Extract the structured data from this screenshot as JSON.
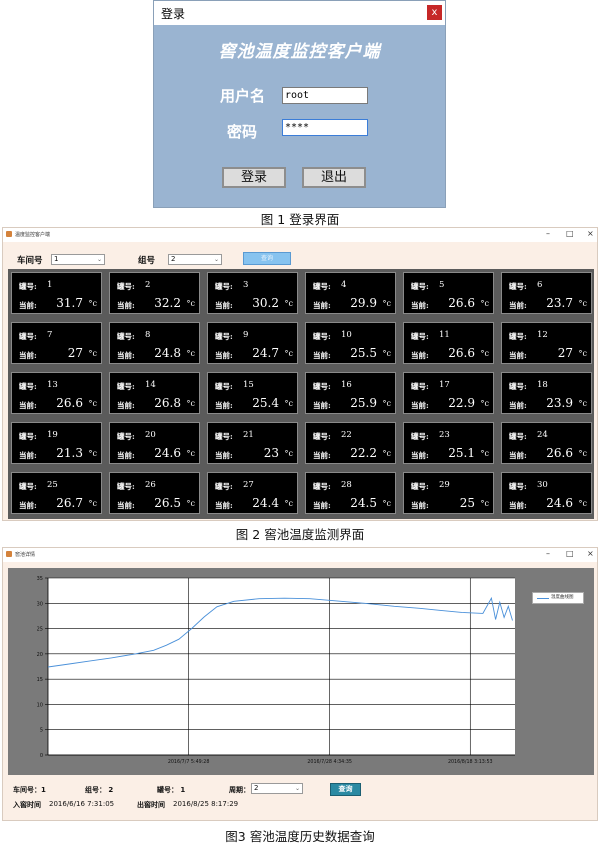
{
  "login": {
    "window_title": "登录",
    "close_label": "x",
    "app_title": "窖池温度监控客户端",
    "username_label": "用户名",
    "username_value": "root",
    "password_label": "密码",
    "password_value": "****",
    "login_button": "登录",
    "exit_button": "退出",
    "caption": "图 1  登录界面"
  },
  "monitor": {
    "window_title": "温度监控客户端",
    "controls": [
      "–",
      "□",
      "×"
    ],
    "workshop_label": "车间号",
    "workshop_value": "1",
    "group_label": "组号",
    "group_value": "2",
    "query_button": "查询",
    "tank_label": "罐号:",
    "current_label": "当前:",
    "unit": "°c",
    "tanks": [
      {
        "id": "1",
        "temp": "31.7"
      },
      {
        "id": "2",
        "temp": "32.2"
      },
      {
        "id": "3",
        "temp": "30.2"
      },
      {
        "id": "4",
        "temp": "29.9"
      },
      {
        "id": "5",
        "temp": "26.6"
      },
      {
        "id": "6",
        "temp": "23.7"
      },
      {
        "id": "7",
        "temp": "27"
      },
      {
        "id": "8",
        "temp": "24.8"
      },
      {
        "id": "9",
        "temp": "24.7"
      },
      {
        "id": "10",
        "temp": "25.5"
      },
      {
        "id": "11",
        "temp": "26.6"
      },
      {
        "id": "12",
        "temp": "27"
      },
      {
        "id": "13",
        "temp": "26.6"
      },
      {
        "id": "14",
        "temp": "26.8"
      },
      {
        "id": "15",
        "temp": "25.4"
      },
      {
        "id": "16",
        "temp": "25.9"
      },
      {
        "id": "17",
        "temp": "22.9"
      },
      {
        "id": "18",
        "temp": "23.9"
      },
      {
        "id": "19",
        "temp": "21.3"
      },
      {
        "id": "20",
        "temp": "24.6"
      },
      {
        "id": "21",
        "temp": "23"
      },
      {
        "id": "22",
        "temp": "22.2"
      },
      {
        "id": "23",
        "temp": "25.1"
      },
      {
        "id": "24",
        "temp": "26.6"
      },
      {
        "id": "25",
        "temp": "26.7"
      },
      {
        "id": "26",
        "temp": "26.5"
      },
      {
        "id": "27",
        "temp": "24.4"
      },
      {
        "id": "28",
        "temp": "24.5"
      },
      {
        "id": "29",
        "temp": "25"
      },
      {
        "id": "30",
        "temp": "24.6"
      }
    ],
    "caption": "图 2  窖池温度监测界面"
  },
  "history": {
    "window_title": "窖池详情",
    "controls": [
      "–",
      "□",
      "×"
    ],
    "legend": "温度曲线图",
    "workshop_text": "车间号：1",
    "group_text": "组号：  2",
    "tank_text": "罐号：  1",
    "period_label": "周期：",
    "period_value": "2",
    "query_button": "查询",
    "in_time_label": "入窖时间",
    "in_time_value": "2016/6/16 7:31:05",
    "out_time_label": "出窖时间",
    "out_time_value": "2016/8/25 8:17:29",
    "caption": "图3  窖池温度历史数据查询",
    "line_color": "#4a90d9"
  },
  "chart_data": {
    "type": "line",
    "ylim": [
      0,
      35
    ],
    "yticks": [
      "0",
      "5",
      "10",
      "15",
      "20",
      "25",
      "30",
      "35"
    ],
    "xlim": [
      0,
      1
    ],
    "xticks": [
      {
        "x": 0.333,
        "label": "2016/7/7 5:49:28"
      },
      {
        "x": 0.667,
        "label": "2016/7/28 4:34:35"
      },
      {
        "x": 1.0,
        "label": "2016/8/18 3:13:53"
      }
    ],
    "series": [
      {
        "values": [
          [
            0.0,
            17.4
          ],
          [
            0.05,
            18.0
          ],
          [
            0.1,
            18.6
          ],
          [
            0.15,
            19.2
          ],
          [
            0.2,
            19.9
          ],
          [
            0.25,
            20.7
          ],
          [
            0.28,
            21.7
          ],
          [
            0.31,
            22.9
          ],
          [
            0.34,
            25.0
          ],
          [
            0.37,
            27.3
          ],
          [
            0.4,
            29.3
          ],
          [
            0.44,
            30.4
          ],
          [
            0.5,
            30.9
          ],
          [
            0.56,
            31.0
          ],
          [
            0.62,
            30.9
          ],
          [
            0.68,
            30.5
          ],
          [
            0.75,
            30.0
          ],
          [
            0.82,
            29.4
          ],
          [
            0.88,
            29.0
          ],
          [
            0.93,
            28.6
          ],
          [
            0.98,
            28.2
          ],
          [
            1.03,
            28.0
          ],
          [
            1.05,
            31.0
          ],
          [
            1.06,
            26.8
          ],
          [
            1.07,
            30.2
          ],
          [
            1.08,
            27.2
          ],
          [
            1.09,
            29.4
          ],
          [
            1.1,
            26.6
          ]
        ]
      }
    ]
  }
}
